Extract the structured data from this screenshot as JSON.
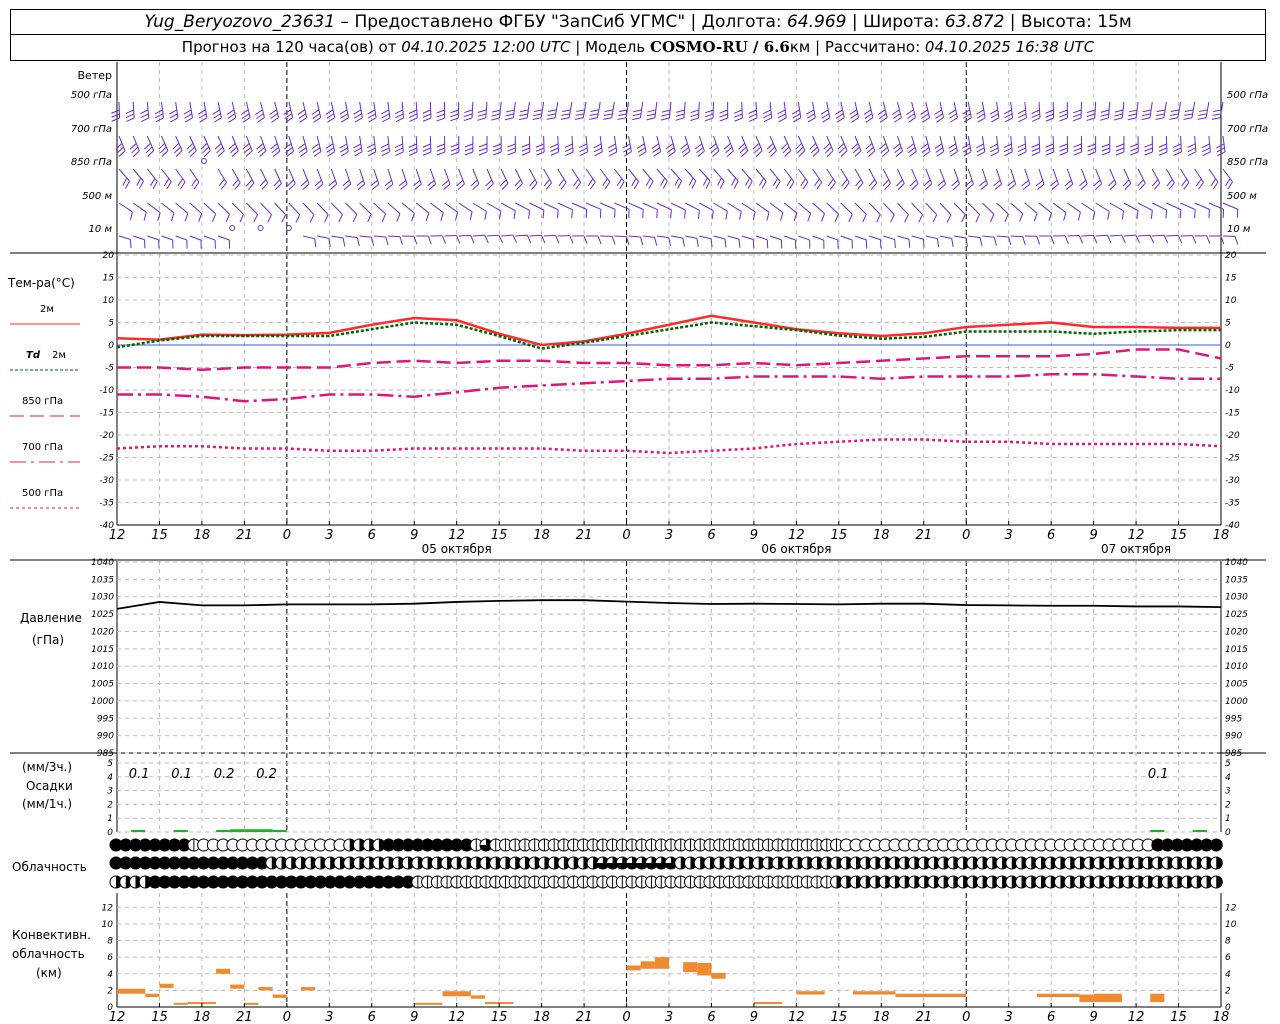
{
  "header": {
    "station": "Yug_Beryozovo_23631",
    "provider": " – Предоставлено ФГБУ \"ЗапСиб УГМС\" | Долгота: ",
    "lon": "64.969",
    "lat_label": " | Широта: ",
    "lat": "63.872",
    "alt_label": " | Высота: 15м",
    "fc_label": "Прогноз на 120 часа(ов) от ",
    "fc_time": "04.10.2025 12:00 UTC",
    "model_label": " | Модель ",
    "model": "COSMO-RU / 6.6",
    "model_unit": "км",
    "calc_label": " | Рассчитано: ",
    "calc_time": "04.10.2025 16:38 UTC"
  },
  "time_axis": {
    "hours": [
      "12",
      "15",
      "18",
      "21",
      "0",
      "3",
      "6",
      "9",
      "12",
      "15",
      "18",
      "21",
      "0",
      "3",
      "6",
      "9",
      "12",
      "15",
      "18",
      "21",
      "0",
      "3",
      "6",
      "9",
      "12",
      "15",
      "18"
    ],
    "dates": [
      {
        "label": "05 октября",
        "index": 8
      },
      {
        "label": "06 октября",
        "index": 16
      },
      {
        "label": "07 октября",
        "index": 24
      }
    ]
  },
  "wind_panel": {
    "title": "Ветер",
    "levels": [
      "500 гПа",
      "700 гПа",
      "850 гПа",
      "500 м",
      "10 м"
    ],
    "color": "#6a2ccf"
  },
  "chart_data": [
    {
      "type": "line",
      "title": "Тем-ра(°C)",
      "ylim": [
        -40,
        20
      ],
      "yticks": [
        "20",
        "15",
        "10",
        "5",
        "0",
        "-5",
        "-10",
        "-15",
        "-20",
        "-25",
        "-30",
        "-35",
        "-40"
      ],
      "x": [
        0,
        3,
        6,
        9,
        12,
        15,
        18,
        21,
        24,
        27,
        30,
        33,
        36,
        39,
        42,
        45,
        48,
        51,
        54,
        57,
        60,
        63,
        66,
        69,
        72,
        75,
        78
      ],
      "series": [
        {
          "name": "2м",
          "color": "#ff2a2a",
          "style": "solid",
          "values": [
            1.5,
            1.2,
            2.3,
            2.2,
            2.3,
            2.7,
            4.5,
            6,
            5.5,
            2.5,
            0,
            0.8,
            2.5,
            4.5,
            6.5,
            5,
            3.5,
            2.6,
            2,
            2.6,
            4,
            4.5,
            5,
            4,
            4,
            3.8,
            3.8
          ]
        },
        {
          "name": "Td",
          "name_suffix": "2м",
          "color": "#006400",
          "style": "dotted",
          "values": [
            -0.5,
            1,
            2,
            2,
            2,
            2,
            3.5,
            5,
            4.5,
            2,
            -0.8,
            0.5,
            2,
            3.5,
            5,
            4.2,
            3.3,
            2.1,
            1.4,
            1.8,
            3,
            3,
            3,
            2.5,
            3,
            3.3,
            3.3
          ]
        },
        {
          "name": "850 гПа",
          "color": "#e0157a",
          "style": "dash",
          "values": [
            -5,
            -5,
            -5.5,
            -5,
            -5,
            -5,
            -4,
            -3.5,
            -4,
            -3.5,
            -3.5,
            -4,
            -4,
            -4.5,
            -4.5,
            -4,
            -4.5,
            -4,
            -3.5,
            -3,
            -2.5,
            -2.5,
            -2.5,
            -2,
            -1,
            -1,
            -3
          ]
        },
        {
          "name": "700 гПа",
          "color": "#e0157a",
          "style": "dashdot",
          "values": [
            -11,
            -11,
            -11.5,
            -12.5,
            -12,
            -11,
            -11,
            -11.5,
            -10.5,
            -9.5,
            -9,
            -8.5,
            -8,
            -7.5,
            -7.5,
            -7,
            -7,
            -7,
            -7.5,
            -7,
            -7,
            -7,
            -6.5,
            -6.5,
            -7,
            -7.5,
            -7.5
          ]
        },
        {
          "name": "500 гПа",
          "color": "#e0157a",
          "style": "finedot",
          "values": [
            -23,
            -22.5,
            -22.5,
            -23,
            -23,
            -23.5,
            -23.5,
            -23,
            -23,
            -23,
            -23,
            -23.5,
            -23.5,
            -24,
            -23.5,
            -23,
            -22,
            -21.5,
            -21,
            -21,
            -21.5,
            -21.5,
            -22,
            -22,
            -22,
            -22,
            -22.5
          ]
        }
      ]
    },
    {
      "type": "line",
      "title": "Давление",
      "unit": "(гПа)",
      "ylim": [
        985,
        1040
      ],
      "yticks": [
        "1040",
        "1035",
        "1030",
        "1025",
        "1020",
        "1015",
        "1010",
        "1005",
        "1000",
        "995",
        "990",
        "985"
      ],
      "x": [
        0,
        3,
        6,
        9,
        12,
        15,
        18,
        21,
        24,
        27,
        30,
        33,
        36,
        39,
        42,
        45,
        48,
        51,
        54,
        57,
        60,
        63,
        66,
        69,
        72,
        75,
        78
      ],
      "series": [
        {
          "color": "#000000",
          "values": [
            1026.5,
            1028.5,
            1027.5,
            1027.5,
            1027.8,
            1027.8,
            1027.8,
            1028,
            1028.5,
            1028.8,
            1029,
            1029,
            1028.6,
            1028.2,
            1027.9,
            1028,
            1027.9,
            1027.8,
            1028,
            1028,
            1027.6,
            1027.5,
            1027.4,
            1027.4,
            1027.2,
            1027.2,
            1027
          ]
        }
      ]
    },
    {
      "type": "bar",
      "title": "Осадки",
      "unit_top": "(мм/3ч.)",
      "unit_bottom": "(мм/1ч.)",
      "ylim": [
        0,
        5
      ],
      "yticks": [
        "5",
        "4",
        "3",
        "2",
        "1",
        "0"
      ],
      "labels": [
        {
          "x": 1,
          "text": "0.1"
        },
        {
          "x": 4,
          "text": "0.1"
        },
        {
          "x": 7,
          "text": "0.2"
        },
        {
          "x": 10,
          "text": "0.2"
        },
        {
          "x": 73,
          "text": "0.1"
        }
      ],
      "bars_x": [
        1,
        4,
        7,
        8,
        9,
        10,
        11,
        73,
        76
      ],
      "bars_y": [
        0.1,
        0.05,
        0.1,
        0.2,
        0.2,
        0.2,
        0.15,
        0.05,
        0.05
      ],
      "color": "#21b021"
    },
    {
      "type": "bar",
      "title": "Конвективн.",
      "title2": "облачность",
      "unit": "(км)",
      "ylim": [
        0,
        13
      ],
      "yticks": [
        "12",
        "10",
        "8",
        "6",
        "4",
        "2",
        "0"
      ],
      "color": "#f08a30",
      "bars": [
        [
          0,
          2,
          1.6,
          2.2
        ],
        [
          2,
          3,
          1.2,
          1.6
        ],
        [
          3,
          4,
          2.3,
          2.8
        ],
        [
          4,
          5,
          0.3,
          0.5
        ],
        [
          5,
          7,
          0.4,
          0.6
        ],
        [
          7,
          8,
          4,
          4.6
        ],
        [
          8,
          9,
          2.2,
          2.7
        ],
        [
          9,
          10,
          0.3,
          0.5
        ],
        [
          10,
          11,
          2,
          2.4
        ],
        [
          11,
          12,
          1.1,
          1.5
        ],
        [
          13,
          14,
          2,
          2.4
        ],
        [
          21,
          23,
          0.3,
          0.5
        ],
        [
          23,
          25,
          1.3,
          1.9
        ],
        [
          25,
          26,
          1,
          1.4
        ],
        [
          26,
          28,
          0.4,
          0.6
        ],
        [
          36,
          37,
          4.4,
          5
        ],
        [
          37,
          38,
          4.6,
          5.5
        ],
        [
          38,
          39,
          4.6,
          6
        ],
        [
          40,
          41,
          4.2,
          5.4
        ],
        [
          41,
          42,
          3.8,
          5.3
        ],
        [
          42,
          43,
          3.4,
          4.1
        ],
        [
          45,
          47,
          0.4,
          0.6
        ],
        [
          48,
          50,
          1.5,
          1.9
        ],
        [
          52,
          55,
          1.5,
          1.9
        ],
        [
          55,
          60,
          1.2,
          1.6
        ],
        [
          65,
          68,
          1.2,
          1.6
        ],
        [
          68,
          69,
          0.6,
          1.5
        ],
        [
          69,
          71,
          0.6,
          1.6
        ],
        [
          73,
          74,
          0.6,
          1.6
        ]
      ]
    }
  ],
  "clouds": {
    "title": "Облачность",
    "rows": [
      "444444441000000000000000222244444444413111111111111111111111111111111111111000000000000000000000000000000004444444",
      "444444444444444422222222222222222222222222222222223333333322222222222222222222222222222222222222222222222222222222",
      "222244444444444444444444444444411111111111111111111111111111111111111111112222222222222222222222222222222222222222"
    ]
  }
}
